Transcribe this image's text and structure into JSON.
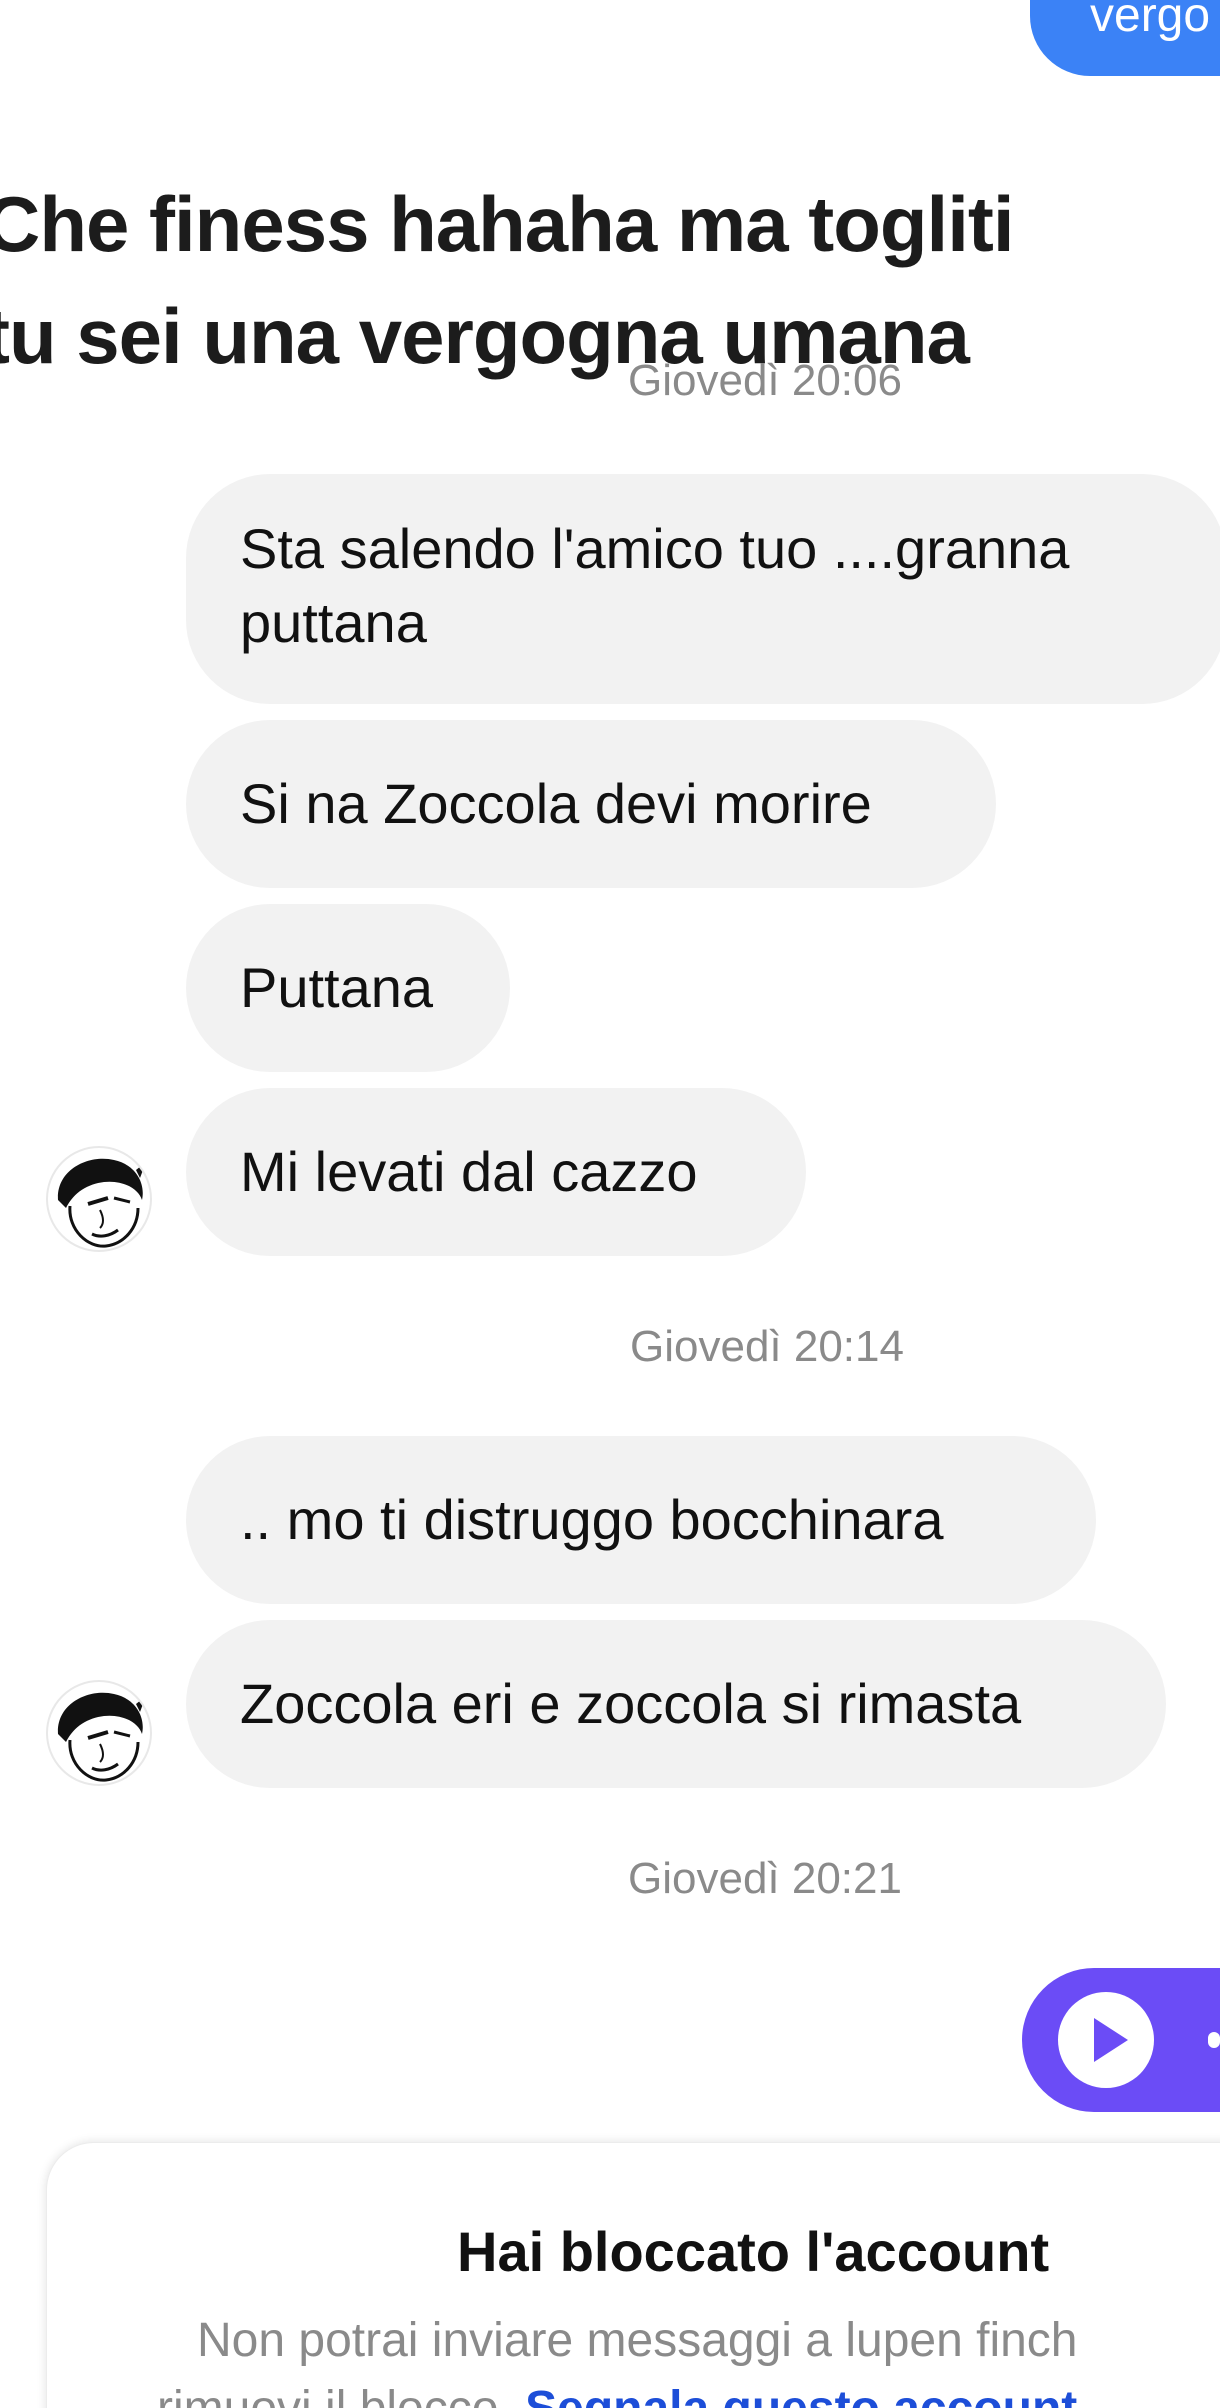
{
  "sent_top": {
    "text": "vergo"
  },
  "overlay": {
    "line1": "Che finess hahaha ma togliti",
    "line2": "tu sei una vergogna umana"
  },
  "timestamps": [
    "Giovedì 20:06",
    "Giovedì 20:14",
    "Giovedì 20:21"
  ],
  "messages": [
    {
      "text_line1": "Sta salendo l'amico tuo ....granna",
      "text_line2": "puttana"
    },
    {
      "text": "Si na Zoccola devi morire"
    },
    {
      "text": "Puttana"
    },
    {
      "text": "Mi levati dal cazzo"
    },
    {
      "text": ".. mo ti distruggo bocchinara"
    },
    {
      "text": "Zoccola eri e zoccola si rimasta"
    }
  ],
  "blocked": {
    "title": "Hai bloccato l'account",
    "desc_line1": "Non potrai inviare messaggi a lupen finch",
    "desc_line2_prefix": "rimuovi il blocco.",
    "report_link": "Segnala questo account"
  },
  "colors": {
    "sent_bubble": "#3b82f6",
    "received_bubble": "#f2f2f2",
    "voice_bubble": "#6b4cf6",
    "timestamp": "#8a8a8a",
    "link": "#1d4ed8"
  },
  "icons": {
    "avatar": "caricature-avatar",
    "voice_play": "play-icon"
  }
}
